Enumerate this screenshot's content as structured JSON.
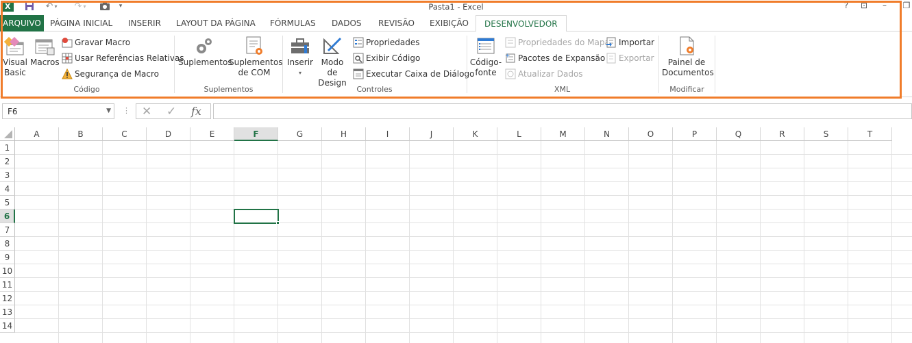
{
  "window": {
    "title": "Pasta1 - Excel",
    "help": "?",
    "restore": "⊡",
    "minimize": "–"
  },
  "tabs": [
    {
      "label": "ARQUIVO"
    },
    {
      "label": "PÁGINA INICIAL"
    },
    {
      "label": "INSERIR"
    },
    {
      "label": "LAYOUT DA PÁGINA"
    },
    {
      "label": "FÓRMULAS"
    },
    {
      "label": "DADOS"
    },
    {
      "label": "REVISÃO"
    },
    {
      "label": "EXIBIÇÃO"
    },
    {
      "label": "DESENVOLVEDOR"
    }
  ],
  "ribbon": {
    "codigo": {
      "label": "Código",
      "visual_basic_1": "Visual",
      "visual_basic_2": "Basic",
      "macros": "Macros",
      "gravar_macro": "Gravar Macro",
      "usar_referencias": "Usar Referências Relativas",
      "seguranca_macro": "Segurança de Macro"
    },
    "suplementos": {
      "label": "Suplementos",
      "suplementos": "Suplementos",
      "suplementos_com_1": "Suplementos",
      "suplementos_com_2": "de COM"
    },
    "controles": {
      "label": "Controles",
      "inserir": "Inserir",
      "modo_design_1": "Modo de",
      "modo_design_2": "Design",
      "propriedades": "Propriedades",
      "exibir_codigo": "Exibir Código",
      "executar_caixa": "Executar Caixa de Diálogo"
    },
    "xml": {
      "label": "XML",
      "codigo_fonte_1": "Código-",
      "codigo_fonte_2": "fonte",
      "propriedades_mapa": "Propriedades do Mapa",
      "pacotes_expansao": "Pacotes de Expansão",
      "atualizar_dados": "Atualizar Dados",
      "importar": "Importar",
      "exportar": "Exportar"
    },
    "modificar": {
      "label": "Modificar",
      "painel_1": "Painel de",
      "painel_2": "Documentos"
    }
  },
  "formula_bar": {
    "name_box": "F6",
    "formula": ""
  },
  "grid": {
    "columns": [
      "A",
      "B",
      "C",
      "D",
      "E",
      "F",
      "G",
      "H",
      "I",
      "J",
      "K",
      "L",
      "M",
      "N",
      "O",
      "P",
      "Q",
      "R",
      "S",
      "T"
    ],
    "rows": [
      "1",
      "2",
      "3",
      "4",
      "5",
      "6",
      "7",
      "8",
      "9",
      "10",
      "11",
      "12",
      "13",
      "14"
    ],
    "selected_column": "F",
    "selected_row": "6"
  },
  "colors": {
    "accent": "#217346",
    "highlight_frame": "#f07c2a"
  }
}
